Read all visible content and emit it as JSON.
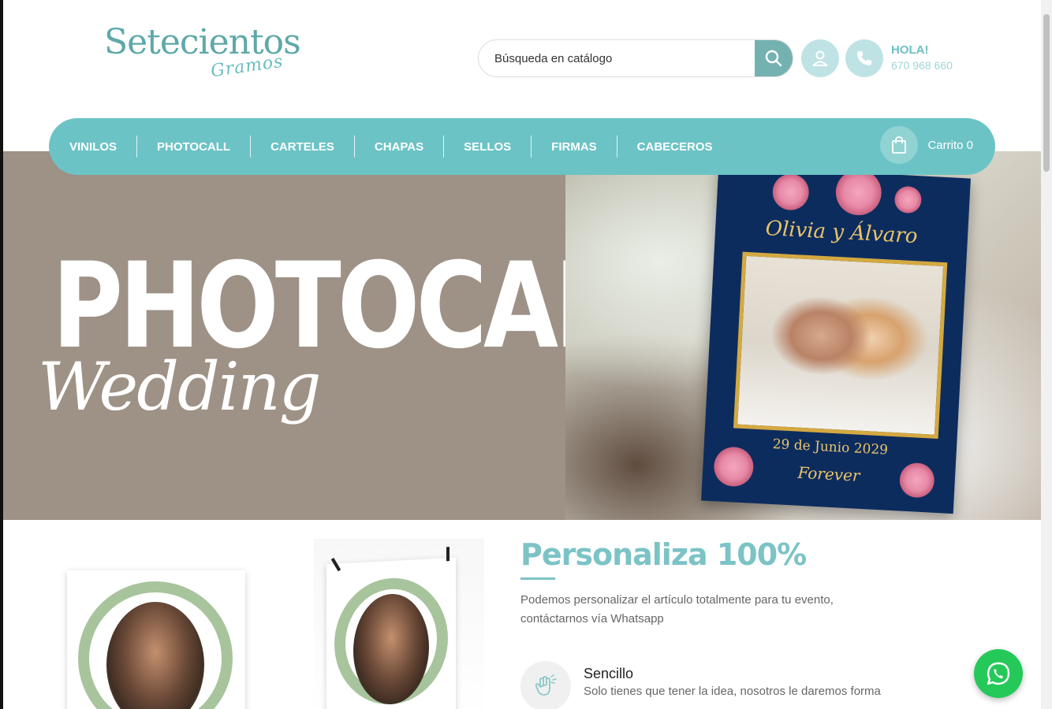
{
  "brand": {
    "name": "Setecientos",
    "script": "Gramos"
  },
  "search": {
    "placeholder": "Búsqueda en catálogo"
  },
  "contact": {
    "greeting": "HOLA!",
    "phone": "670 968 660"
  },
  "nav": {
    "items": [
      {
        "label": "VINILOS"
      },
      {
        "label": "PHOTOCALL"
      },
      {
        "label": "CARTELES"
      },
      {
        "label": "CHAPAS"
      },
      {
        "label": "SELLOS"
      },
      {
        "label": "FIRMAS"
      },
      {
        "label": "CABECEROS"
      }
    ],
    "cart_label": "Carrito 0"
  },
  "hero": {
    "title": "PHOTOCALL",
    "subtitle": "Wedding",
    "poster": {
      "names": "Olivia y Álvaro",
      "date": "29 de Junio 2029",
      "tagline": "Forever"
    }
  },
  "section": {
    "title": "Personaliza 100%",
    "description": "Podemos personalizar el artículo totalmente para tu evento, contáctarnos vía Whatsapp",
    "feature": {
      "title": "Sencillo",
      "description": "Solo tienes que tener la idea, nosotros le daremos forma"
    }
  },
  "colors": {
    "accent": "#6cc3c5",
    "hero_left_bg": "#9e9186",
    "whatsapp": "#25c95a",
    "poster_navy": "#0d2c5e",
    "gold": "#e9c46a"
  },
  "icons": {
    "search": "search-icon",
    "user": "user-icon",
    "phone": "phone-icon",
    "cart": "shopping-bag-icon",
    "whatsapp": "whatsapp-icon",
    "feature": "hand-icon"
  }
}
